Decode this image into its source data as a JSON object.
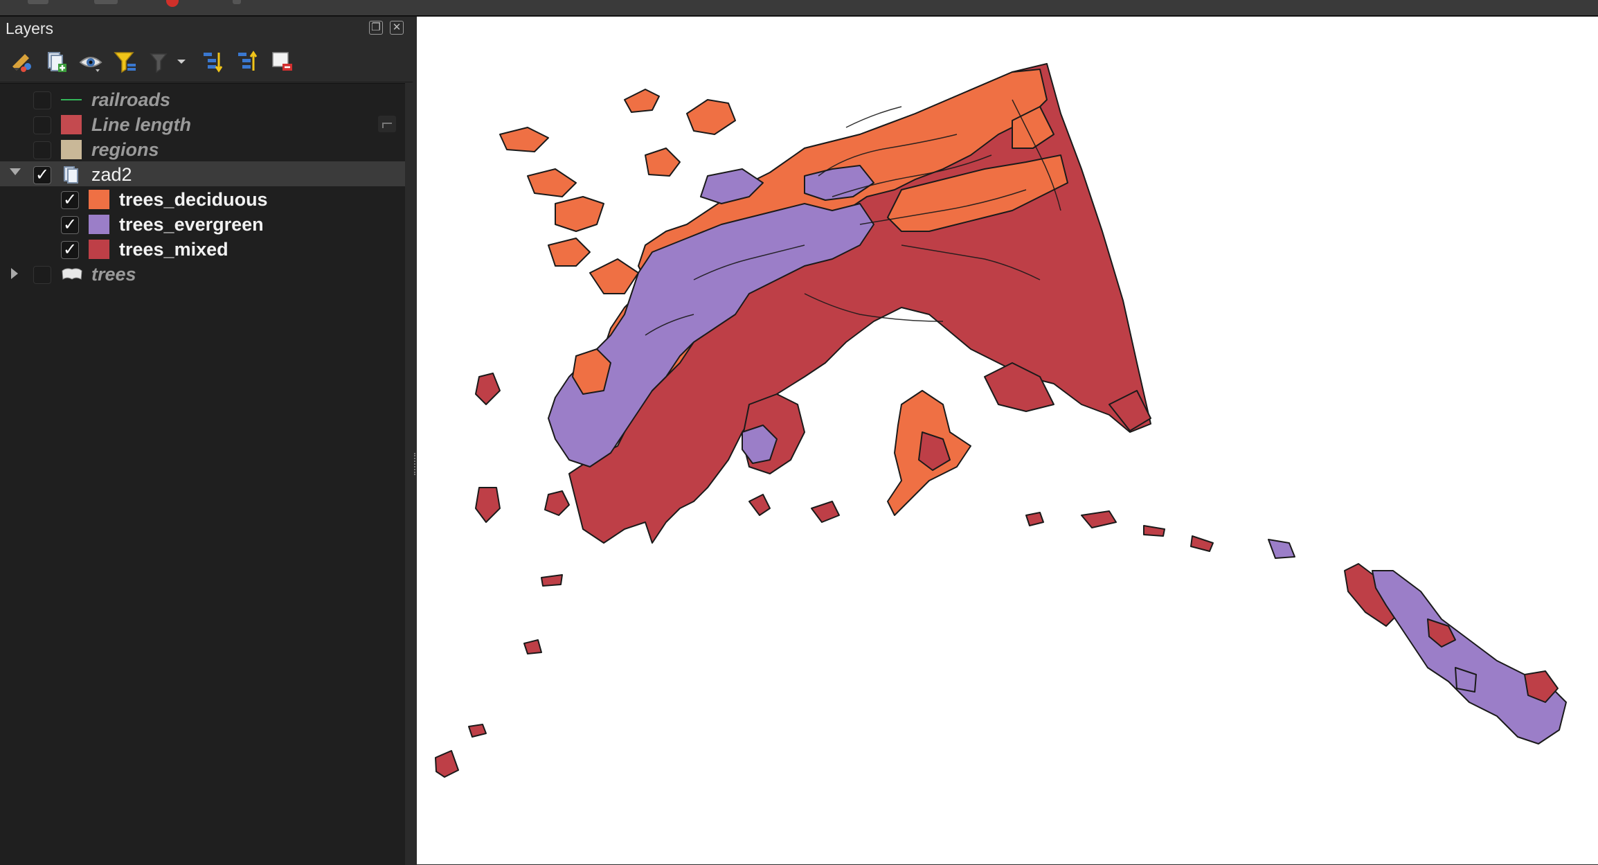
{
  "window": {
    "title": "Layers"
  },
  "panel": {
    "title": "Layers",
    "header_buttons": [
      {
        "name": "float-panel-icon"
      },
      {
        "name": "close-panel-icon"
      }
    ],
    "toolbar": [
      {
        "name": "style-manager-icon"
      },
      {
        "name": "add-group-icon"
      },
      {
        "name": "visibility-icon"
      },
      {
        "name": "filter-legend-icon"
      },
      {
        "name": "filter-expression-icon"
      },
      {
        "name": "expand-all-icon"
      },
      {
        "name": "collapse-all-icon"
      },
      {
        "name": "remove-layer-icon"
      }
    ]
  },
  "layers": [
    {
      "label": "railroads",
      "checked": false,
      "symbol": "line",
      "color": "#33b65a"
    },
    {
      "label": "Line length",
      "checked": false,
      "symbol": "fill",
      "color": "#c44a4f"
    },
    {
      "label": "regions",
      "checked": false,
      "symbol": "fill",
      "color": "#c9b898"
    },
    {
      "label": "zad2",
      "checked": true,
      "symbol": "group",
      "expanded": true,
      "children": [
        {
          "label": "trees_deciduous",
          "checked": true,
          "color": "#ef7044"
        },
        {
          "label": "trees_evergreen",
          "checked": true,
          "color": "#9b7ec8"
        },
        {
          "label": "trees_mixed",
          "checked": true,
          "color": "#be3f47"
        }
      ]
    },
    {
      "label": "trees",
      "checked": false,
      "symbol": "raster-group",
      "expanded": false
    }
  ],
  "map": {
    "background": "#ffffff",
    "fill_colors": {
      "deciduous": "#ef7044",
      "evergreen": "#9b7ec8",
      "mixed": "#be3f47"
    },
    "outline": "#1a1a1a"
  }
}
